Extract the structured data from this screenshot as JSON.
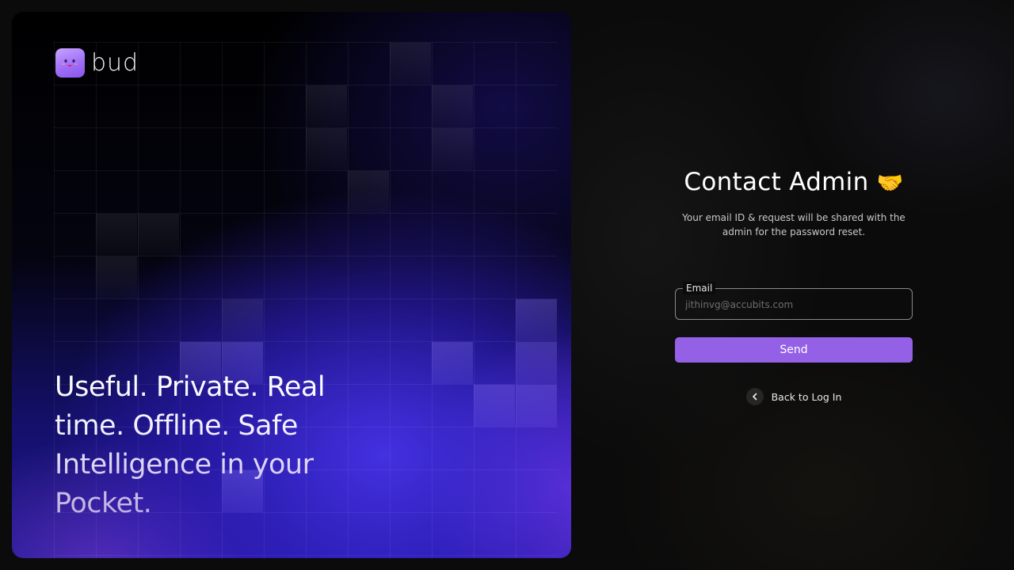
{
  "brand": {
    "logo_icon": "smiley-face-icon",
    "wordmark": "bud"
  },
  "hero": {
    "tagline": "Useful. Private. Real time. Offline. Safe Intelligence in your Pocket."
  },
  "form": {
    "title": "Contact Admin",
    "title_emoji": "🤝",
    "subtitle": "Your email ID & request will be shared with the admin for the password reset.",
    "email_label": "Email",
    "email_placeholder": "jithinvg@accubits.com",
    "send_label": "Send",
    "back_label": "Back to Log In",
    "back_icon": "chevron-left-icon"
  },
  "colors": {
    "accent": "#9461e6",
    "background": "#0b0b0b",
    "hero_glow": "#3b2ad6"
  }
}
